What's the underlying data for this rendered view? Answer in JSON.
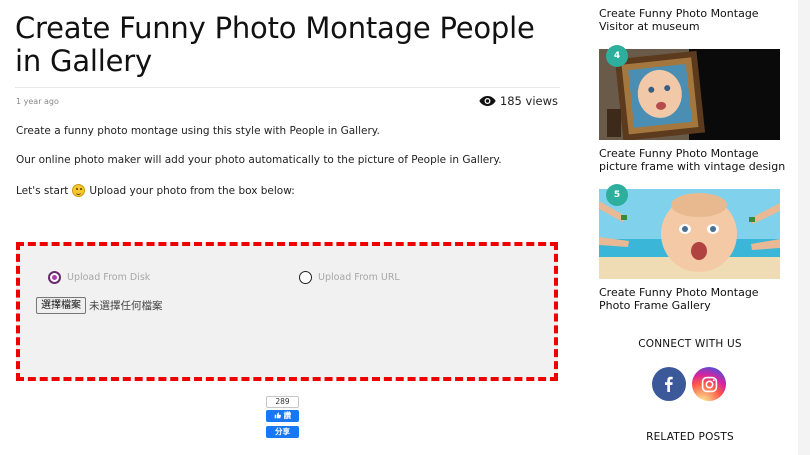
{
  "article": {
    "title": "Create Funny Photo Montage People in Gallery",
    "date": "1 year ago",
    "views": "185 views",
    "paragraphs": [
      "Create a funny photo montage using this style with People in Gallery.",
      "Our online photo maker will add your photo automatically to the picture of People in Gallery."
    ],
    "start_before": "Let's start",
    "start_after": "Upload your photo from the box below:"
  },
  "uploader": {
    "option_disk": "Upload From Disk",
    "option_url": "Upload From URL",
    "selected": "disk",
    "file_button": "選擇檔案",
    "file_status": "未選擇任何檔案"
  },
  "facebook": {
    "count": "289",
    "like_label": "讚",
    "share_label": "分享"
  },
  "sidebar": {
    "posts": [
      {
        "title": "Create Funny Photo Montage Visitor at museum"
      },
      {
        "number": "4",
        "title": "Create Funny Photo Montage picture frame with vintage design",
        "image": "baby-in-wooden-frame"
      },
      {
        "number": "5",
        "title": "Create Funny Photo Montage Photo Frame Gallery",
        "image": "baby-on-beach"
      }
    ],
    "connect_heading": "CONNECT WITH US",
    "social": [
      {
        "icon": "facebook-icon",
        "color": "#3b5998"
      },
      {
        "icon": "instagram-icon",
        "color": "#d6249f"
      }
    ],
    "related_heading": "RELATED POSTS"
  },
  "colors": {
    "accent_badge": "#2eaf9e",
    "upload_border": "#ee0000"
  }
}
